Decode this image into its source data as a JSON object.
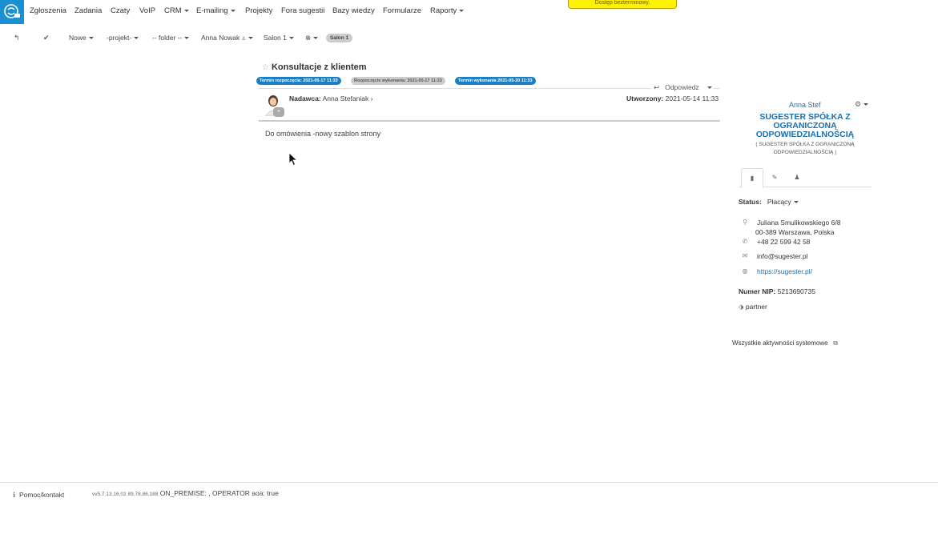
{
  "nav": {
    "items": [
      "Zgłoszenia",
      "Zadania",
      "Czaty",
      "VoIP",
      "CRM",
      "E-mailing",
      "Projekty",
      "Fora sugestii",
      "Bazy wiedzy",
      "Formularze",
      "Raporty"
    ],
    "banner": "Dostęp bezterminowy."
  },
  "toolbar": {
    "status": "Nowe",
    "project": "-projekt-",
    "folder": "-- folder --",
    "user": "Anna Nowak",
    "salon": "Salon 1",
    "salon_pill": "Salon 1"
  },
  "ticket": {
    "title": "Konsultacje z klientem",
    "badge_start": "Termin rozpoczęcia: 2021-05-17 11:33",
    "badge_exec_start": "Rozpoczęcie wykonania: 2021-05-17 11:33",
    "badge_deadline": "Termin wykonania 2021-05-20 11:33",
    "reply_label": "Odpowiedz",
    "sender_label": "Nadawca:",
    "sender_name": "Anna Stefaniak",
    "created_label": "Utworzony:",
    "created_value": "2021-05-14 11:33",
    "message": "Do omówienia -nowy szablon strony"
  },
  "contact": {
    "user": "Anna Stef",
    "company": "SUGESTER SPÓŁKA Z OGRANICZONĄ ODPOWIEDZIALNOŚCIĄ",
    "company_sub": "( SUGESTER SPÓŁKA Z OGRANICZONĄ ODPOWIEDZIALNOŚCIĄ )",
    "status_label": "Status:",
    "status_value": "Płacący",
    "address_line1": "Juliana Smulikowskiego 6/8",
    "address_line2": "00-389 Warszawa, Polska",
    "phone": "+48 22 599 42 58",
    "email": "info@sugester.pl",
    "website": "https://sugester.pl/",
    "nip_label": "Numer NIP:",
    "nip_value": "5213690735",
    "tag": "partner",
    "activities": "Wszystkie aktywności systemowe"
  },
  "footer": {
    "help": "Pomoc/kontakt",
    "version_small": "vv5.7.13.16.02 89.78.86.188",
    "version_rest": "ON_PREMISE: , OPERATOR aoa: true"
  },
  "colors": {
    "brand": "#1a8fd1",
    "badge_blue": "#1a7fc4",
    "link": "#1a6fb0",
    "banner": "#fff200"
  }
}
